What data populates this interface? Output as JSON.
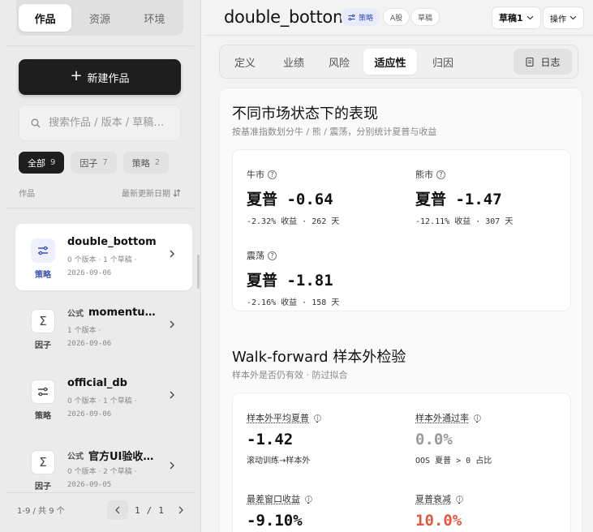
{
  "sidebar": {
    "tabs": [
      {
        "label": "作品",
        "active": true
      },
      {
        "label": "资源",
        "active": false
      },
      {
        "label": "环境",
        "active": false
      }
    ],
    "new_button": "新建作品",
    "search_placeholder": "搜索作品 / 版本 / 草稿…",
    "filters": [
      {
        "label": "全部",
        "count": "9",
        "active": true
      },
      {
        "label": "因子",
        "count": "7",
        "active": false
      },
      {
        "label": "策略",
        "count": "2",
        "active": false
      }
    ],
    "list_header": {
      "left": "作品",
      "sort": "最新更新日期"
    },
    "items": [
      {
        "prefix": "",
        "title": "double_bottom",
        "meta": "0 个版本 · 1 个草稿 ·",
        "date": "2026-09-06",
        "kind": "策略",
        "icon": "strategy-icon",
        "active": true
      },
      {
        "prefix": "公式",
        "title": "momentu…",
        "meta": "1 个版本 ·",
        "date": "2026-09-06",
        "kind": "因子",
        "icon": "sigma-icon",
        "active": false
      },
      {
        "prefix": "",
        "title": "official_db",
        "meta": "0 个版本 · 1 个草稿 ·",
        "date": "2026-09-06",
        "kind": "策略",
        "icon": "strategy-icon",
        "active": false
      },
      {
        "prefix": "公式",
        "title": "官方UI验收…",
        "meta": "0 个版本 · 2 个草稿 ·",
        "date": "2026-09-05",
        "kind": "因子",
        "icon": "sigma-icon",
        "active": false
      }
    ],
    "pager": {
      "range": "1-9 / 共 9 个",
      "current": "1",
      "total": "1",
      "sep": "/"
    }
  },
  "header": {
    "title": "double_bottom",
    "tags": [
      "策略",
      "A股",
      "草稿"
    ],
    "draft_select": "草稿1",
    "actions": "操作"
  },
  "tabs": [
    {
      "label": "定义",
      "active": false
    },
    {
      "label": "业绩",
      "active": false
    },
    {
      "label": "风险",
      "active": false
    },
    {
      "label": "适应性",
      "active": true
    },
    {
      "label": "归因",
      "active": false
    }
  ],
  "log_button": "日志",
  "regime": {
    "title": "不同市场状态下的表现",
    "subtitle": "按基准指数划分牛 / 熊 / 震荡，分别统计夏普与收益",
    "cards": [
      {
        "label": "牛市",
        "sharpe_prefix": "夏普",
        "sharpe": "-0.64",
        "ret": "-2.32%",
        "ret_label": "收益",
        "days": "262",
        "days_label": "天"
      },
      {
        "label": "熊市",
        "sharpe_prefix": "夏普",
        "sharpe": "-1.47",
        "ret": "-12.11%",
        "ret_label": "收益",
        "days": "307",
        "days_label": "天"
      },
      {
        "label": "震荡",
        "sharpe_prefix": "夏普",
        "sharpe": "-1.81",
        "ret": "-2.16%",
        "ret_label": "收益",
        "days": "158",
        "days_label": "天"
      }
    ]
  },
  "walkforward": {
    "title": "Walk-forward 样本外检验",
    "subtitle": "样本外是否仍有效 · 防过拟合",
    "metrics": [
      {
        "label": "样本外平均夏普",
        "value": "-1.42",
        "sub": "滚动训练→样本外"
      },
      {
        "label": "样本外通过率",
        "value": "0.0%",
        "sub_prefix": "OOS 夏普 > 0",
        "sub_suffix": "占比"
      },
      {
        "label": "最差窗口收益",
        "value": "-9.10%"
      },
      {
        "label": "夏普衰减",
        "value": "10.0%"
      }
    ]
  }
}
